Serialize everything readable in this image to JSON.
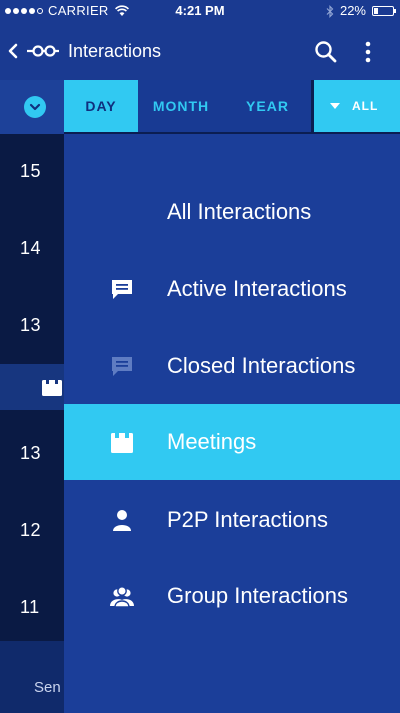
{
  "status_bar": {
    "carrier": "CARRIER",
    "time": "4:21 PM",
    "battery": "22%",
    "battery_level": 0.22,
    "signal_bars_filled": 4,
    "signal_bars_total": 5
  },
  "app_bar": {
    "title": "Interactions",
    "icons": [
      "back-arrow-icon",
      "connections-logo-icon",
      "search-icon",
      "more-vertical-icon"
    ]
  },
  "filter_bar": {
    "tabs": [
      {
        "label": "DAY",
        "active": true
      },
      {
        "label": "MONTH",
        "active": false
      },
      {
        "label": "YEAR",
        "active": false
      }
    ],
    "filter_label": "ALL"
  },
  "timeline": {
    "numbers": [
      "15",
      "14",
      "13",
      "13",
      "12",
      "11"
    ],
    "footer_text": "Sen"
  },
  "menu": {
    "items": [
      {
        "label": "All Interactions",
        "icon": "none",
        "selected": false
      },
      {
        "label": "Active Interactions",
        "icon": "chat-bubble-icon",
        "selected": false
      },
      {
        "label": "Closed Interactions",
        "icon": "chat-bubble-faded-icon",
        "selected": false
      },
      {
        "label": "Meetings",
        "icon": "calendar-icon",
        "selected": true
      },
      {
        "label": "P2P Interactions",
        "icon": "person-icon",
        "selected": false
      },
      {
        "label": "Group Interactions",
        "icon": "group-icon",
        "selected": false
      }
    ]
  },
  "colors": {
    "primary": "#1a3a91",
    "accent": "#31c9f2",
    "timeline_bg": "#0a1a44",
    "menu_bg": "#1b3e99"
  }
}
